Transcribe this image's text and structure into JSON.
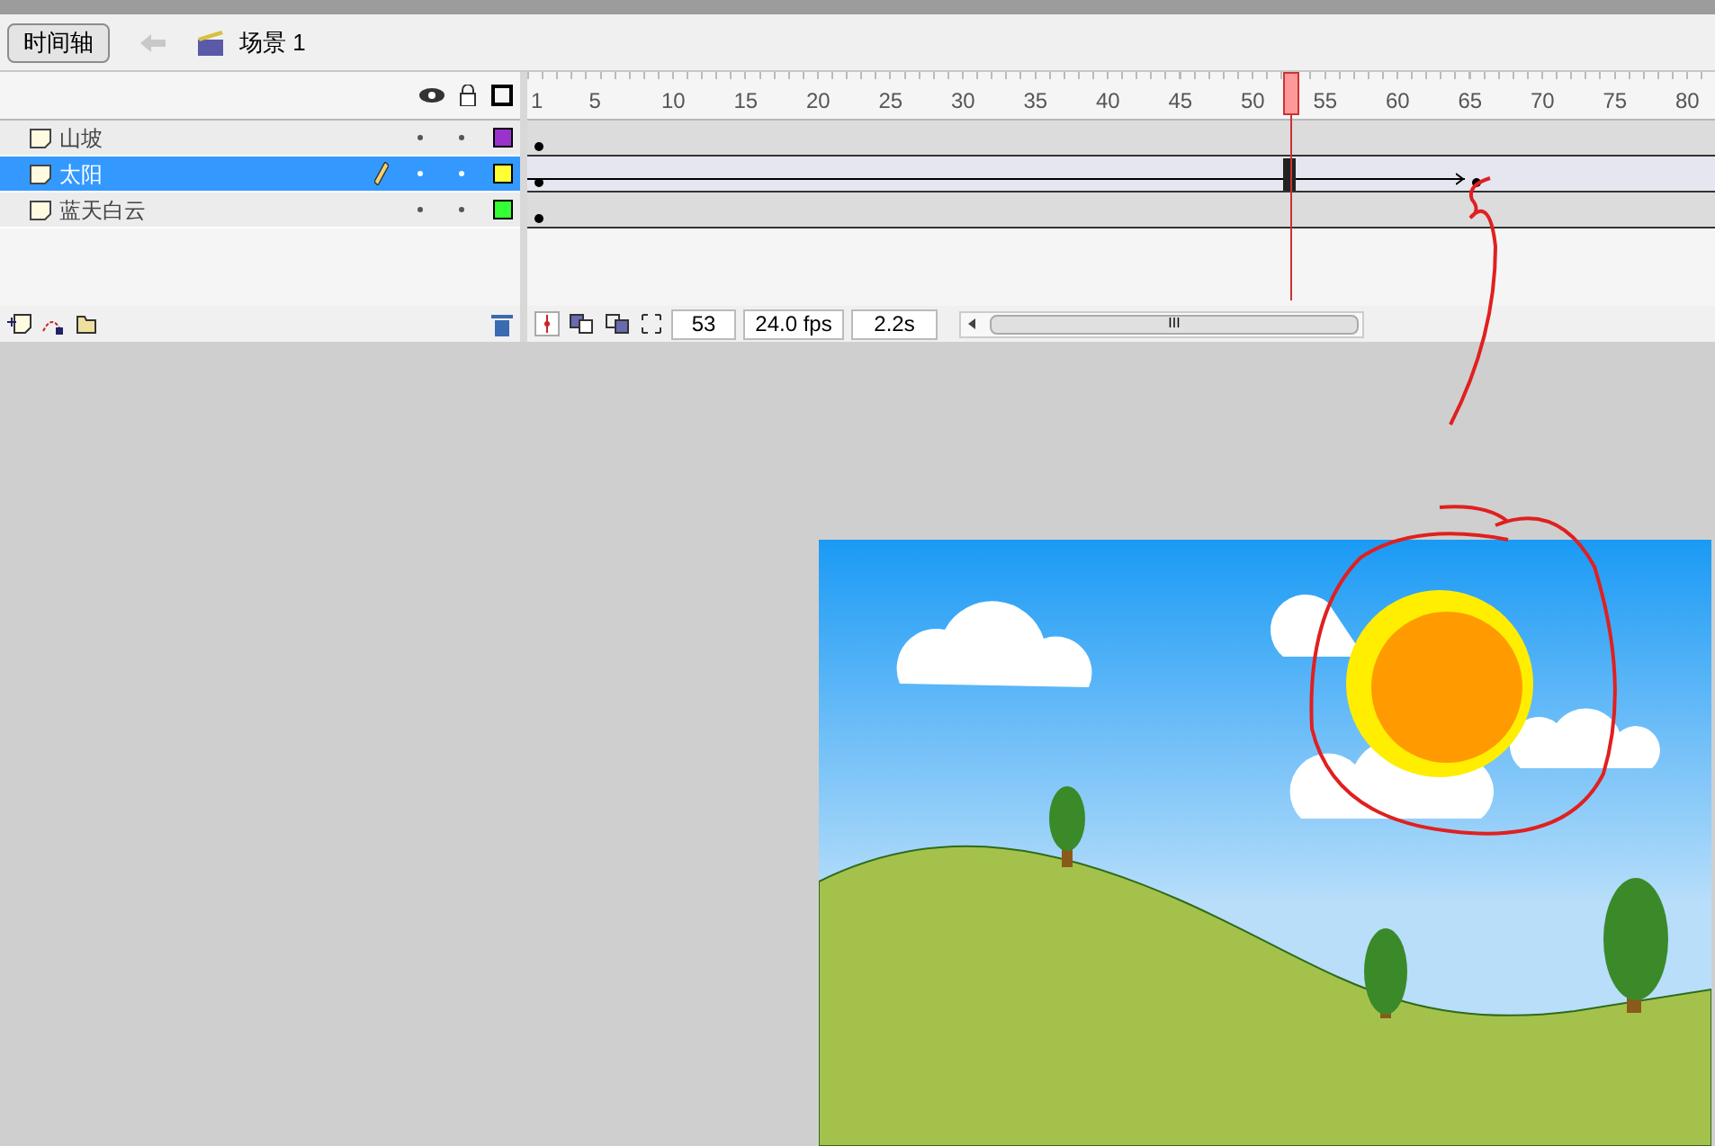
{
  "toolbar": {
    "timeline_button": "时间轴",
    "scene": "场景 1"
  },
  "ruler": [
    "1",
    "5",
    "10",
    "15",
    "20",
    "25",
    "30",
    "35",
    "40",
    "45",
    "50",
    "55",
    "60",
    "65",
    "70",
    "75",
    "80"
  ],
  "layers": [
    {
      "name": "山坡",
      "selected": false,
      "editing": false,
      "color": "#9933cc",
      "tween": false
    },
    {
      "name": "太阳",
      "selected": true,
      "editing": true,
      "color": "#ffff33",
      "tween": {
        "level": 0.79
      }
    },
    {
      "name": "蓝天白云",
      "selected": false,
      "editing": false,
      "color": "#33ff33",
      "tween": false
    }
  ],
  "status": {
    "current_frame": "53",
    "fps": "24.0 fps",
    "elapsed": "2.2s",
    "scroll_grip": "III"
  }
}
